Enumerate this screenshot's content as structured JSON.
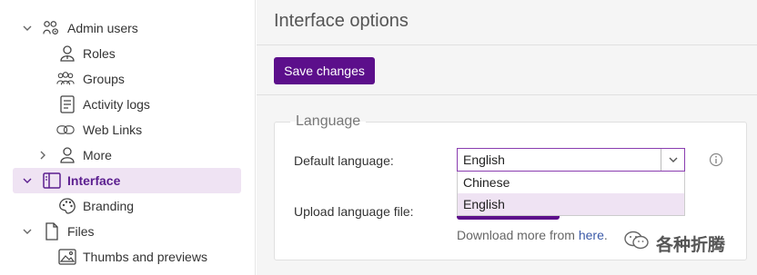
{
  "sidebar": {
    "items": [
      {
        "label": "Admin users",
        "icon": "users-gear-icon",
        "expanded": true
      },
      {
        "label": "Roles",
        "icon": "user-badge-icon"
      },
      {
        "label": "Groups",
        "icon": "group-icon"
      },
      {
        "label": "Activity logs",
        "icon": "log-icon"
      },
      {
        "label": "Web Links",
        "icon": "link-icon"
      },
      {
        "label": "More",
        "icon": "user-icon",
        "expanded": false
      },
      {
        "label": "Interface",
        "icon": "layout-icon",
        "expanded": true,
        "active": true
      },
      {
        "label": "Branding",
        "icon": "palette-icon"
      },
      {
        "label": "Files",
        "icon": "file-icon",
        "expanded": true
      },
      {
        "label": "Thumbs and previews",
        "icon": "image-icon"
      }
    ]
  },
  "header": {
    "title": "Interface options"
  },
  "toolbar": {
    "save_label": "Save changes"
  },
  "language_panel": {
    "legend": "Language",
    "default_language_label": "Default language:",
    "selected_language": "English",
    "options": [
      "Chinese",
      "English"
    ],
    "upload_label": "Upload language file:",
    "download_text": "Download more from ",
    "download_link": "here",
    "download_suffix": "."
  },
  "watermark": {
    "text": "各种折腾"
  },
  "colors": {
    "accent": "#5c0f8b",
    "active_bg": "#efe3f3",
    "active_text": "#5b1e8f",
    "link": "#3b5aa8"
  }
}
